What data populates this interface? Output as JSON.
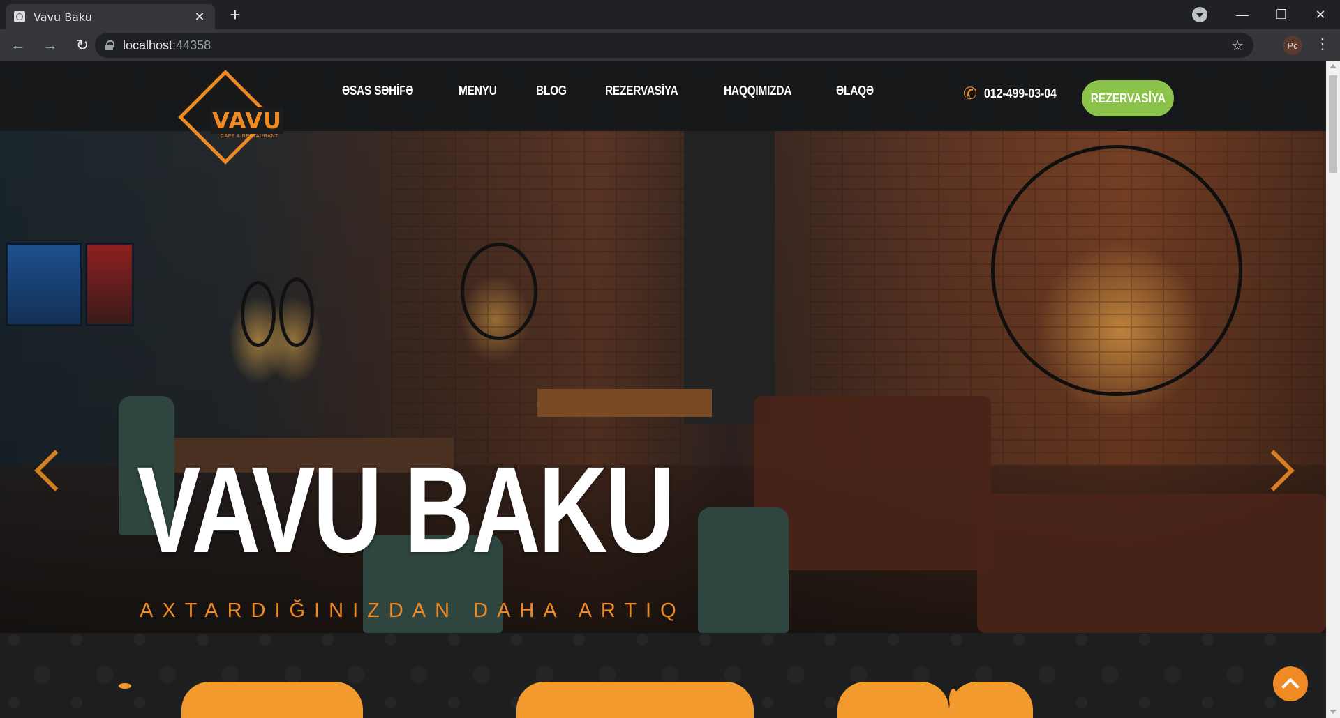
{
  "browser": {
    "tab_title": "Vavu Baku",
    "url_host": "localhost",
    "url_port": ":44358",
    "profile_initials": "Pc"
  },
  "header": {
    "logo_text": "VAVU",
    "logo_subtext": "CAFE & RESTAURANT",
    "nav": [
      "ƏSAS SƏHİFƏ",
      "MENYU",
      "BLOG",
      "REZERVASİYA",
      "HAQQIMIZDA",
      "ƏLAQƏ"
    ],
    "phone": "012-499-03-04",
    "reserve_label": "REZERVASİYA"
  },
  "hero": {
    "title": "VAVU BAKU",
    "subtitle": "AXTARDIĞINIZDAN DAHA ARTIQ"
  },
  "colors": {
    "accent": "#f08a24",
    "button": "#8bc34a",
    "background": "#1c1e20"
  },
  "icons": [
    "phone-icon",
    "chevron-left-icon",
    "chevron-right-icon",
    "arrow-up-icon",
    "lock-icon",
    "star-icon"
  ]
}
